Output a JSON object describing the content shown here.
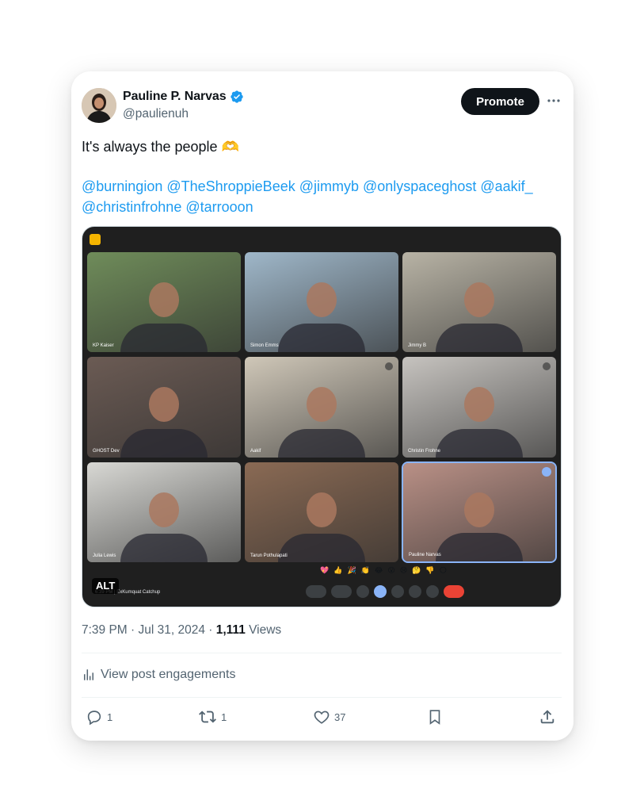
{
  "author": {
    "name": "Pauline P. Narvas",
    "handle": "@paulienuh",
    "verified": true
  },
  "promote_label": "Promote",
  "tweet": {
    "text": "It's always the people 🫶",
    "mentions": [
      "@burningion",
      "@TheShroppieBeek",
      "@jimmyb",
      "@onlyspaceghost",
      "@aakif_",
      "@christinfrohne",
      "@tarrooon"
    ]
  },
  "media": {
    "alt_label": "ALT",
    "meeting_info": "6:39 PM  |  ExKumquat Catchup",
    "reactions": [
      "💖",
      "👍",
      "🎉",
      "👏",
      "😂",
      "😮",
      "😢",
      "🤔",
      "👎",
      "🌕"
    ],
    "tiles": [
      {
        "label": "KP Kaiser",
        "bg": "#6f8c5a"
      },
      {
        "label": "Simon Emms",
        "bg": "#9fb7c9"
      },
      {
        "label": "Jimmy B",
        "bg": "#b8b3a5"
      },
      {
        "label": "GHOST Dev",
        "bg": "#6b5b54"
      },
      {
        "label": "Aakif",
        "bg": "#cfc7b8"
      },
      {
        "label": "Christin Frohne",
        "bg": "#c6c3bf"
      },
      {
        "label": "Julia Lewis",
        "bg": "#d8d8d4"
      },
      {
        "label": "Tarun Pothulapati",
        "bg": "#8a6a54"
      },
      {
        "label": "Pauline Narvas",
        "bg": "#b99086"
      }
    ]
  },
  "meta": {
    "time": "7:39 PM · Jul 31, 2024 · ",
    "views_count": "1,111",
    "views_label": " Views"
  },
  "engagements_label": "View post engagements",
  "actions": {
    "replies": "1",
    "reposts": "1",
    "likes": "37"
  },
  "colors": {
    "accent": "#1d9bf0",
    "text": "#0f1419",
    "muted": "#536471"
  }
}
